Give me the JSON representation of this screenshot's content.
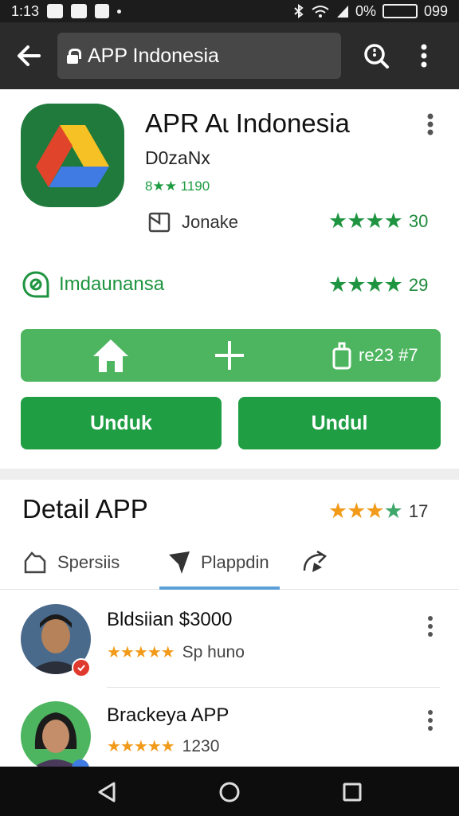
{
  "status_bar": {
    "time": "1:13",
    "battery_percent": "0%",
    "right_text": "099"
  },
  "toolbar": {
    "url": "APP Indonesia"
  },
  "app": {
    "title": "APR Aɩ Indonesia",
    "developer": "D0zaNx",
    "rating_label": "8★★ 1190",
    "info_text": "Jonake",
    "info_rating": "30",
    "tag_text": "Imdaunansa",
    "tag_rating": "29",
    "icon_colors": {
      "background": "#1f7a3c",
      "yellow": "#f6c124",
      "red": "#e0452b",
      "blue": "#3f7be3"
    }
  },
  "actions": {
    "share_label": "re23 #7",
    "download_left": "Unduk",
    "download_right": "Undul"
  },
  "details": {
    "title": "Detail APP",
    "rating": "17",
    "tabs": [
      {
        "label": "Spersiis",
        "icon": "outline-shape-icon"
      },
      {
        "label": "Plappdin",
        "icon": "paper-plane-icon",
        "active": true
      },
      {
        "label": "",
        "icon": "send-icon"
      }
    ]
  },
  "reviews": [
    {
      "name": "Bldsiian $3000",
      "sub": "Sp huno",
      "stars": "★★★★★"
    },
    {
      "name": "Brackeya APP",
      "sub": "1230",
      "stars": "★★★★★"
    }
  ],
  "colors": {
    "accent_green": "#1f9e43",
    "light_green": "#4db55f",
    "star_orange": "#f29a1a",
    "tab_indicator": "#5c9fd6"
  }
}
